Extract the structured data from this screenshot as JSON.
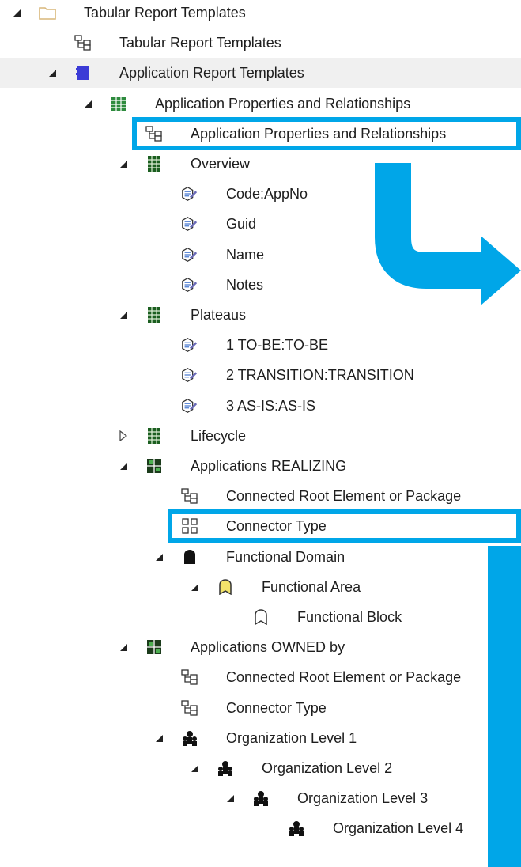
{
  "tree": {
    "items": [
      {
        "label": "Tabular Report Templates",
        "level": 0,
        "expander": "expanded",
        "icon": "folder-icon"
      },
      {
        "label": "Tabular Report Templates",
        "level": 1,
        "expander": "none",
        "icon": "report-template-icon"
      },
      {
        "label": "Application Report Templates",
        "level": 1,
        "expander": "expanded",
        "icon": "package-icon",
        "selected": true
      },
      {
        "label": "Application Properties and Relationships",
        "level": 2,
        "expander": "expanded",
        "icon": "table-icon"
      },
      {
        "label": "Application Properties and Relationships",
        "level": 3,
        "expander": "none",
        "icon": "report-template-icon",
        "highlighted": true
      },
      {
        "label": "Overview",
        "level": 3,
        "expander": "expanded",
        "icon": "section-icon"
      },
      {
        "label": "Code:AppNo",
        "level": 4,
        "expander": "none",
        "icon": "property-icon"
      },
      {
        "label": "Guid",
        "level": 4,
        "expander": "none",
        "icon": "property-icon"
      },
      {
        "label": "Name",
        "level": 4,
        "expander": "none",
        "icon": "property-icon"
      },
      {
        "label": "Notes",
        "level": 4,
        "expander": "none",
        "icon": "property-icon"
      },
      {
        "label": "Plateaus",
        "level": 3,
        "expander": "expanded",
        "icon": "section-icon"
      },
      {
        "label": "1 TO-BE:TO-BE",
        "level": 4,
        "expander": "none",
        "icon": "property-icon"
      },
      {
        "label": "2 TRANSITION:TRANSITION",
        "level": 4,
        "expander": "none",
        "icon": "property-icon"
      },
      {
        "label": "3 AS-IS:AS-IS",
        "level": 4,
        "expander": "none",
        "icon": "property-icon"
      },
      {
        "label": "Lifecycle",
        "level": 3,
        "expander": "collapsed",
        "icon": "section-icon"
      },
      {
        "label": "Applications REALIZING",
        "level": 3,
        "expander": "expanded",
        "icon": "relationship-table-icon"
      },
      {
        "label": "Connected Root Element or Package",
        "level": 4,
        "expander": "none",
        "icon": "report-template-icon"
      },
      {
        "label": "Connector Type",
        "level": 4,
        "expander": "none",
        "icon": "connector-type-icon",
        "highlighted": true
      },
      {
        "label": "Functional Domain",
        "level": 4,
        "expander": "expanded",
        "icon": "functional-domain-icon"
      },
      {
        "label": "Functional Area",
        "level": 5,
        "expander": "expanded",
        "icon": "functional-area-icon"
      },
      {
        "label": "Functional Block",
        "level": 6,
        "expander": "none",
        "icon": "functional-block-icon"
      },
      {
        "label": "Applications OWNED by",
        "level": 3,
        "expander": "expanded",
        "icon": "relationship-table-icon"
      },
      {
        "label": "Connected Root Element or Package",
        "level": 4,
        "expander": "none",
        "icon": "report-template-icon"
      },
      {
        "label": "Connector Type",
        "level": 4,
        "expander": "none",
        "icon": "report-template-icon"
      },
      {
        "label": "Organization Level 1",
        "level": 4,
        "expander": "expanded",
        "icon": "organization-icon"
      },
      {
        "label": "Organization Level 2",
        "level": 5,
        "expander": "expanded",
        "icon": "organization-icon"
      },
      {
        "label": "Organization Level 3",
        "level": 6,
        "expander": "expanded",
        "icon": "organization-icon"
      },
      {
        "label": "Organization Level 4",
        "level": 7,
        "expander": "none",
        "icon": "organization-icon"
      }
    ]
  },
  "colors": {
    "highlight": "#00a6e8",
    "selection_bg": "#f0f0f0",
    "folder": "#d9b77a",
    "package": "#3b3bd6",
    "table": "#2e8b3e",
    "functional_area": "#f2e36b"
  }
}
